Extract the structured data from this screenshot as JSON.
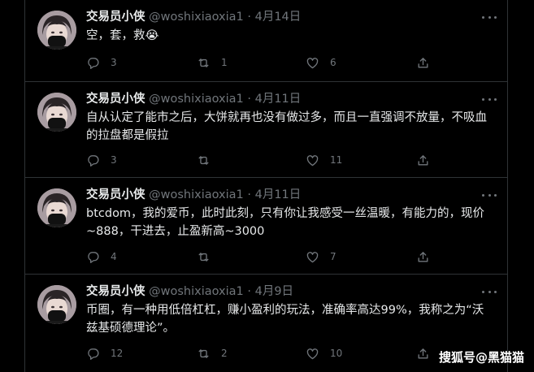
{
  "tweets": [
    {
      "name": "交易员小侠",
      "handle": "@woshixiaoxia1",
      "separator": "·",
      "time": "4月14日",
      "text": "空，套，救😭",
      "replies": "3",
      "retweets": "1",
      "likes": "6"
    },
    {
      "name": "交易员小侠",
      "handle": "@woshixiaoxia1",
      "separator": "·",
      "time": "4月11日",
      "text": "自从认定了能市之后，大饼就再也没有做过多，而且一直强调不放量，不吸血的拉盘都是假拉",
      "replies": "3",
      "retweets": "",
      "likes": "11"
    },
    {
      "name": "交易员小侠",
      "handle": "@woshixiaoxia1",
      "separator": "·",
      "time": "4月11日",
      "text": "btcdom，我的爱币，此时此刻，只有你让我感受一丝温暖，有能力的，现价~888，干进去，止盈新高~3000",
      "replies": "4",
      "retweets": "",
      "likes": "7"
    },
    {
      "name": "交易员小侠",
      "handle": "@woshixiaoxia1",
      "separator": "·",
      "time": "4月9日",
      "text": "币圈，有一种用低倍杠杠，赚小盈利的玩法，准确率高达99%，我称之为“沃兹基硕德理论”。",
      "replies": "12",
      "retweets": "2",
      "likes": "10"
    }
  ],
  "watermark": "搜狐号@黑猫猫",
  "icons": {
    "reply": "reply-icon",
    "retweet": "retweet-icon",
    "like": "like-icon",
    "share": "share-icon",
    "more": "more-icon"
  },
  "colors": {
    "background": "#000000",
    "text": "#e7e9ea",
    "muted": "#71767b",
    "divider": "#2f3336"
  }
}
